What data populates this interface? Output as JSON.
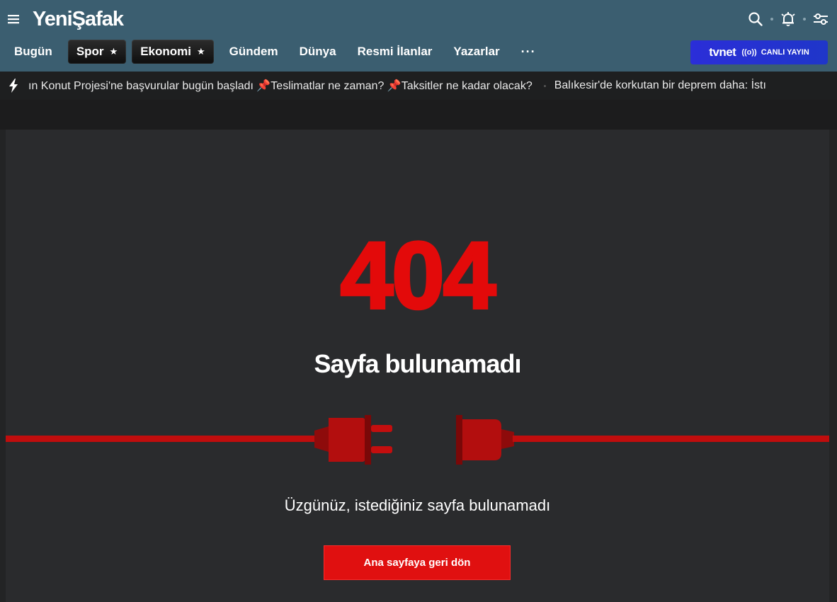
{
  "header": {
    "logo": "YeniŞafak",
    "nav": [
      {
        "label": "Bugün",
        "starred": false
      },
      {
        "label": "Spor",
        "starred": true
      },
      {
        "label": "Ekonomi",
        "starred": true
      },
      {
        "label": "Gündem",
        "starred": false
      },
      {
        "label": "Dünya",
        "starred": false
      },
      {
        "label": "Resmi İlanlar",
        "starred": false
      },
      {
        "label": "Yazarlar",
        "starred": false
      }
    ],
    "more_label": "···",
    "star_glyph": "★",
    "live": {
      "brand": "tvnet",
      "icon_glyph": "((o))",
      "label": "CANLI YAYIN"
    }
  },
  "ticker": {
    "items": [
      "ın Konut Projesi'ne başvurular bugün başladı 📌Teslimatlar ne zaman? 📌Taksitler ne kadar olacak?",
      "Balıkesir'de korkutan bir deprem daha: İstı"
    ]
  },
  "error": {
    "code": "404",
    "title": "Sayfa bulunamadı",
    "message": "Üzgünüz, istediğiniz sayfa bulunamadı",
    "button_label": "Ana sayfaya geri dön"
  },
  "colors": {
    "header_bg": "#3b5e70",
    "accent_red": "#e01010",
    "live_blue": "#2b2ed8",
    "page_bg": "#2a2b2d"
  },
  "icons": {
    "menu": "hamburger-menu-icon",
    "search": "search-icon",
    "alarm": "alarm-bell-icon",
    "settings": "sliders-icon",
    "ticker": "lightning-bolt-icon",
    "illustration": "unplugged-cable-icon"
  }
}
